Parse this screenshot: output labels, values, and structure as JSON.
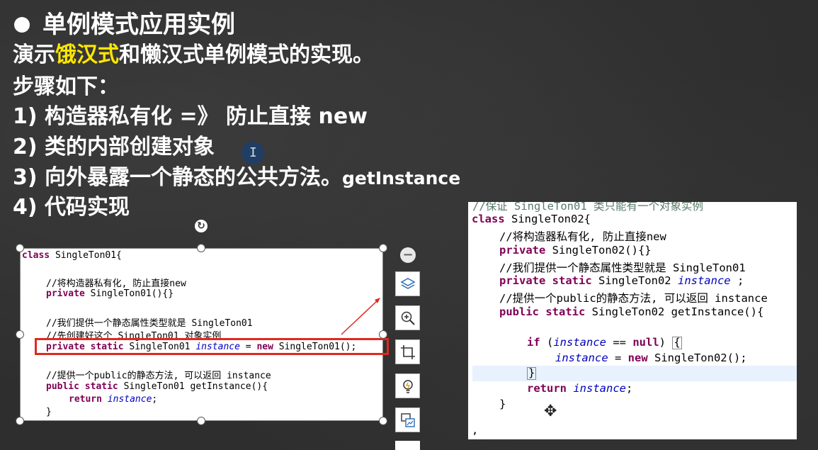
{
  "title": "单例模式应用实例",
  "intro": {
    "prefix": "演示",
    "highlight": "饿汉式",
    "suffix": "和懒汉式单例模式的实现。"
  },
  "steps_heading": "步骤如下：",
  "steps": [
    "1) 构造器私有化 =》 防止直接 new",
    "2) 类的内部创建对象",
    "3) 向外暴露一个静态的公共方法。",
    "4) 代码实现"
  ],
  "step3_suffix": "getInstance",
  "code_left": {
    "l1_kw": "class",
    "l1_rest": " SingleTon01{",
    "l2": "//将构造器私有化, 防止直接new",
    "l3_kw": "private",
    "l3_rest": " SingleTon01(){}",
    "l4": "//我们提供一个静态属性类型就是 SingleTon01",
    "l5": "//先创建好这个 SingleTon01 对象实例",
    "l6_kw": "private static",
    "l6_type": " SingleTon01 ",
    "l6_var": "instance",
    "l6_eq": " = ",
    "l6_new": "new",
    "l6_rest": " SingleTon01();",
    "l7": "//提供一个public的静态方法, 可以返回 instance",
    "l8_kw": "public static",
    "l8_rest": " SingleTon01 getInstance(){",
    "l9_kw": "return",
    "l9_var": "instance",
    "l9_end": ";",
    "l10": "}"
  },
  "code_right": {
    "cut_line": "//保证 SingleTon01 类只能有一个对象实例",
    "l1_kw": "class",
    "l1_rest": " SingleTon02{",
    "l2": "//将构造器私有化, 防止直接new",
    "l3_kw": "private",
    "l3_rest": " SingleTon02(){}",
    "l4": "//我们提供一个静态属性类型就是 SingleTon01",
    "l5_kw": "private static",
    "l5_type": " SingleTon02 ",
    "l5_var": "instance",
    "l5_end": " ;",
    "l6": "//提供一个public的静态方法, 可以返回 instance",
    "l7_kw": "public static",
    "l7_rest": " SingleTon02 getInstance(){",
    "l8_kw": "if",
    "l8_open": " (",
    "l8_var": "instance",
    "l8_eq": " == ",
    "l8_null": "null",
    "l8_close": ") ",
    "l8_brace": "{",
    "l9_var": "instance",
    "l9_eq": " = ",
    "l9_new": "new",
    "l9_rest": " SingleTon02();",
    "l10": "}",
    "l11_kw": "return",
    "l11_var": "instance",
    "l11_end": ";",
    "l12": "}",
    "l13": ","
  },
  "colors": {
    "highlight": "#ffe600",
    "keyword": "#7f0055",
    "comment": "#3f7f5f",
    "instance_var": "#0000c0",
    "selection_box": "#e0281e"
  },
  "icons": [
    "minus-icon",
    "layers-icon",
    "zoom-in-icon",
    "crop-icon",
    "bulb-icon",
    "image-replace-icon",
    "rotate-icon",
    "move-cursor-icon",
    "text-cursor-icon"
  ]
}
